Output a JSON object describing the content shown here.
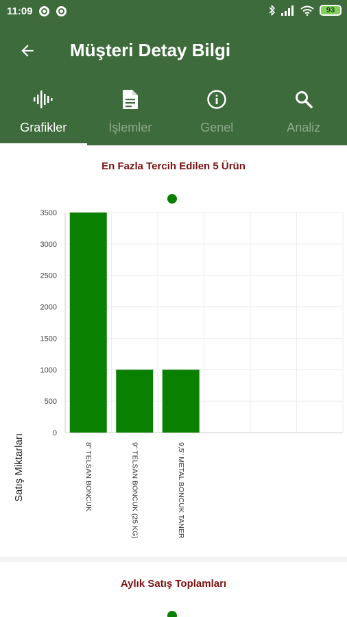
{
  "status_bar": {
    "time": "11:09",
    "battery": "93"
  },
  "app_bar": {
    "title": "Müşteri Detay Bilgi",
    "back_icon": "arrow-back-icon"
  },
  "tabs": [
    {
      "label": "Grafikler",
      "icon": "waveform-icon",
      "active": true
    },
    {
      "label": "İşlemler",
      "icon": "document-icon",
      "active": false
    },
    {
      "label": "Genel",
      "icon": "info-icon",
      "active": false
    },
    {
      "label": "Analiz",
      "icon": "search-icon",
      "active": false
    }
  ],
  "colors": {
    "primary": "#3d6b3b",
    "bar": "#0a8000",
    "title_text": "#7a1010"
  },
  "chart_data": {
    "type": "bar",
    "title": "En Fazla Tercih Edilen 5 Ürün",
    "ylabel": "Satış Miktarları",
    "categories": [
      "8\" TELSAN BONCUK",
      "9\" TELSAN BONCUK (25 KG)",
      "9,5\" METAL BONCUK TANER"
    ],
    "values": [
      3500,
      1000,
      1000
    ],
    "ylim": [
      0,
      3500
    ],
    "yticks": [
      0,
      500,
      1000,
      1500,
      2000,
      2500,
      3000,
      3500
    ],
    "grid": true,
    "legend": "top-center"
  },
  "second_card": {
    "title": "Aylık Satış Toplamları"
  }
}
